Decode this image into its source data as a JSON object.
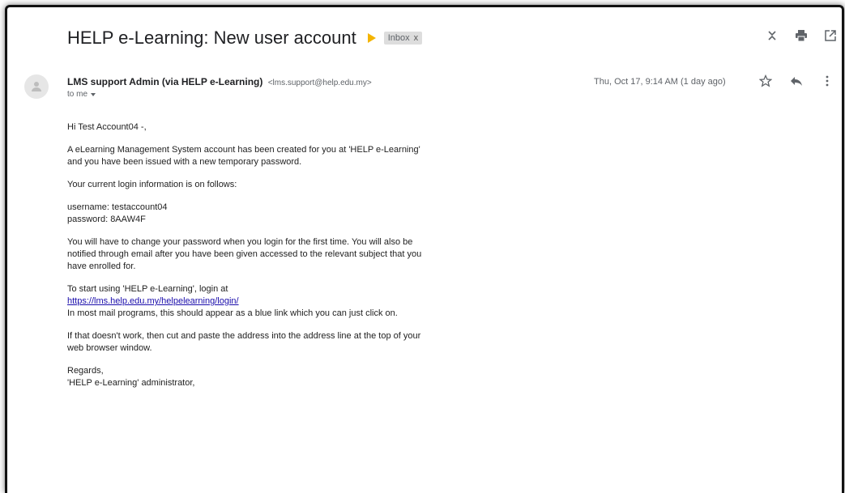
{
  "email": {
    "subject": "HELP e-Learning: New user account",
    "label": "Inbox",
    "label_remove": "x",
    "sender_name": "LMS support Admin (via HELP e-Learning)",
    "sender_email": "<lms.support@help.edu.my>",
    "to": "to me",
    "date": "Thu, Oct 17, 9:14 AM (1 day ago)",
    "body": {
      "greeting": "Hi Test Account04 -,",
      "p1": "A eLearning Management System account has been created for you at 'HELP e-Learning' and you have been issued with a new temporary password.",
      "p2": "Your current login information is on follows:",
      "username": "username: testaccount04",
      "password": "password: 8AAW4F",
      "p3": "You will have to change your password when you login for the first time. You will also be notified through email after you have been given accessed to the relevant subject that you have enrolled for.",
      "p4_intro": "To start using 'HELP e-Learning', login at",
      "p4_link": "https://lms.help.edu.my/helpelearning/login/",
      "p4_outro": "In most mail programs, this should appear as a blue link which you can just click on.",
      "p5": "If that doesn't work, then cut and paste the address into the address line at the top of your web browser window.",
      "regards": "Regards,",
      "signature": "'HELP e-Learning' administrator,"
    }
  },
  "icons": {
    "expand": "unfold-icon",
    "print": "print-icon",
    "popout": "open-in-new-window-icon",
    "star": "star-icon",
    "reply": "reply-icon",
    "more": "more-vert-icon",
    "avatar": "person-icon",
    "important": "important-marker-icon"
  },
  "colors": {
    "important": "#f4b400",
    "link": "#1a0dab",
    "label_bg": "#dddddd"
  }
}
